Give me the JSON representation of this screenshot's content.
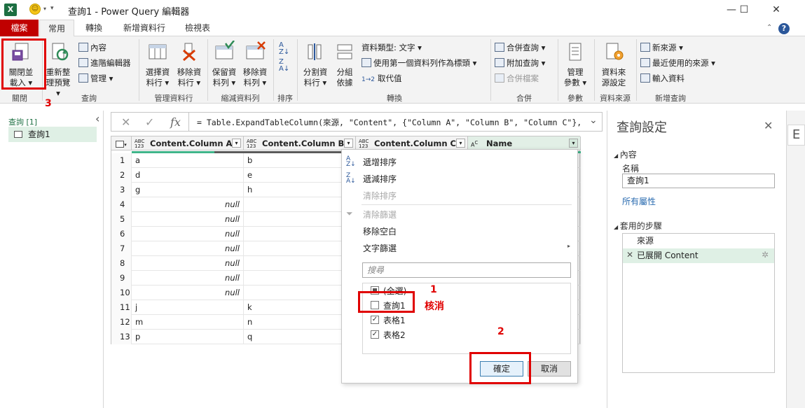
{
  "window": {
    "title": "查詢1 - Power Query 編輯器",
    "app_icon": "X",
    "minimize": "—",
    "maximize": "☐",
    "close": "✕"
  },
  "tabs": [
    {
      "label": "檔案"
    },
    {
      "label": "常用"
    },
    {
      "label": "轉換"
    },
    {
      "label": "新增資料行"
    },
    {
      "label": "檢視表"
    }
  ],
  "help_label": "?",
  "ribbon": {
    "close_load": "關閉並\n載入 ▾",
    "refresh": "重新整\n理預覽 ▾",
    "properties": "內容",
    "advanced_editor": "進階編輯器",
    "manage": "管理 ▾",
    "choose_cols": "選擇資\n料行 ▾",
    "remove_cols": "移除資\n料行 ▾",
    "keep_rows": "保留資\n料列 ▾",
    "remove_rows": "移除資\n料列 ▾",
    "split_col": "分割資\n料行 ▾",
    "group_by": "分組\n依據",
    "data_type": "資料類型: 文字 ▾",
    "first_row_header": "使用第一個資料列作為標頭 ▾",
    "replace_values": "取代值",
    "merge_queries": "合併查詢 ▾",
    "append_queries": "附加查詢 ▾",
    "combine_files": "合併檔案",
    "manage_params": "管理\n參數 ▾",
    "data_source_settings": "資料來\n源設定",
    "new_source": "新來源 ▾",
    "recent_sources": "最近使用的來源 ▾",
    "enter_data": "輸入資料",
    "groups": {
      "close": "關閉",
      "query": "查詢",
      "manage_cols": "管理資料行",
      "reduce_rows": "縮減資料列",
      "sort": "排序",
      "transform": "轉換",
      "combine": "合併",
      "params": "參數",
      "data_sources": "資料來源",
      "new_query": "新增查詢"
    }
  },
  "left_pane": {
    "header": "查詢 [1]",
    "collapse": "‹",
    "items": [
      {
        "label": "查詢1"
      }
    ]
  },
  "formula": {
    "cancel": "✕",
    "confirm": "✓",
    "fx": "fx",
    "text": "= Table.ExpandTableColumn(來源, \"Content\", {\"Column A\", \"Column B\", \"Column C\"},",
    "expand": "⌄"
  },
  "grid": {
    "type_any_top": "ABC",
    "type_any_bottom": "123",
    "type_text_top": "A",
    "type_text_bottom": "C",
    "columns": [
      {
        "name": "Content.Column A"
      },
      {
        "name": "Content.Column B"
      },
      {
        "name": "Content.Column C"
      },
      {
        "name": "Name"
      }
    ],
    "rows": [
      {
        "n": "1",
        "a": "a",
        "b": "b"
      },
      {
        "n": "2",
        "a": "d",
        "b": "e"
      },
      {
        "n": "3",
        "a": "g",
        "b": "h"
      },
      {
        "n": "4",
        "a": "null",
        "b": ""
      },
      {
        "n": "5",
        "a": "null",
        "b": ""
      },
      {
        "n": "6",
        "a": "null",
        "b": ""
      },
      {
        "n": "7",
        "a": "null",
        "b": ""
      },
      {
        "n": "8",
        "a": "null",
        "b": ""
      },
      {
        "n": "9",
        "a": "null",
        "b": ""
      },
      {
        "n": "10",
        "a": "null",
        "b": ""
      },
      {
        "n": "11",
        "a": "j",
        "b": "k"
      },
      {
        "n": "12",
        "a": "m",
        "b": "n"
      },
      {
        "n": "13",
        "a": "p",
        "b": "q"
      }
    ]
  },
  "filter_menu": {
    "sort_asc": "遞增排序",
    "sort_desc": "遞減排序",
    "clear_sort": "清除排序",
    "clear_filter": "清除篩選",
    "remove_empty": "移除空白",
    "text_filters": "文字篩選",
    "search_placeholder": "搜尋",
    "options": [
      {
        "label": "(全選)"
      },
      {
        "label": "查詢1"
      },
      {
        "label": "表格1"
      },
      {
        "label": "表格2"
      }
    ],
    "ok": "確定",
    "cancel": "取消"
  },
  "annotations": {
    "step1": "1",
    "step1_text": "核消",
    "step2": "2",
    "step3": "3"
  },
  "settings": {
    "title": "查詢設定",
    "close": "✕",
    "properties_header": "內容",
    "name_label": "名稱",
    "name_value": "查詢1",
    "all_properties": "所有屬性",
    "steps_header": "套用的步驟",
    "steps": [
      {
        "label": "來源"
      },
      {
        "label": "已展開 Content"
      }
    ],
    "edge_tab": "E"
  },
  "colors": {
    "file_tab": "#c00000",
    "accent_green": "#217346",
    "selection_green": "#dff0e5",
    "annotation_red": "#e00000"
  }
}
